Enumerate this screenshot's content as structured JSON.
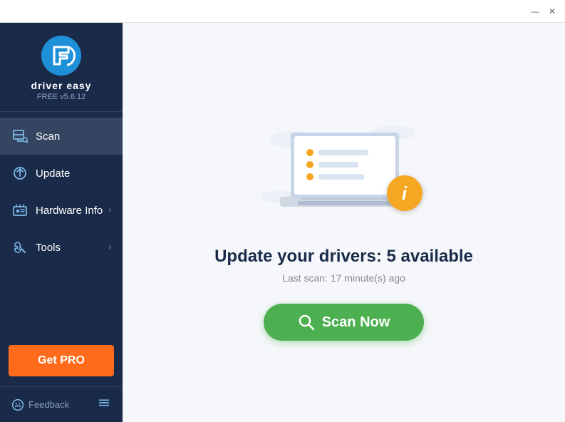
{
  "titlebar": {
    "minimize_label": "—",
    "close_label": "✕"
  },
  "sidebar": {
    "logo_text": "driver easy",
    "logo_version": "FREE v5.6.12",
    "nav_items": [
      {
        "id": "scan",
        "label": "Scan",
        "icon": "scan-icon",
        "has_chevron": false,
        "active": true
      },
      {
        "id": "update",
        "label": "Update",
        "icon": "update-icon",
        "has_chevron": false,
        "active": false
      },
      {
        "id": "hardware-info",
        "label": "Hardware Info",
        "icon": "hardware-icon",
        "has_chevron": true,
        "active": false
      },
      {
        "id": "tools",
        "label": "Tools",
        "icon": "tools-icon",
        "has_chevron": true,
        "active": false
      }
    ],
    "get_pro_label": "Get PRO",
    "feedback_label": "Feedback"
  },
  "content": {
    "update_title": "Update your drivers: 5 available",
    "last_scan_text": "Last scan: 17 minute(s) ago",
    "scan_now_label": "Scan Now",
    "info_badge": "i"
  }
}
